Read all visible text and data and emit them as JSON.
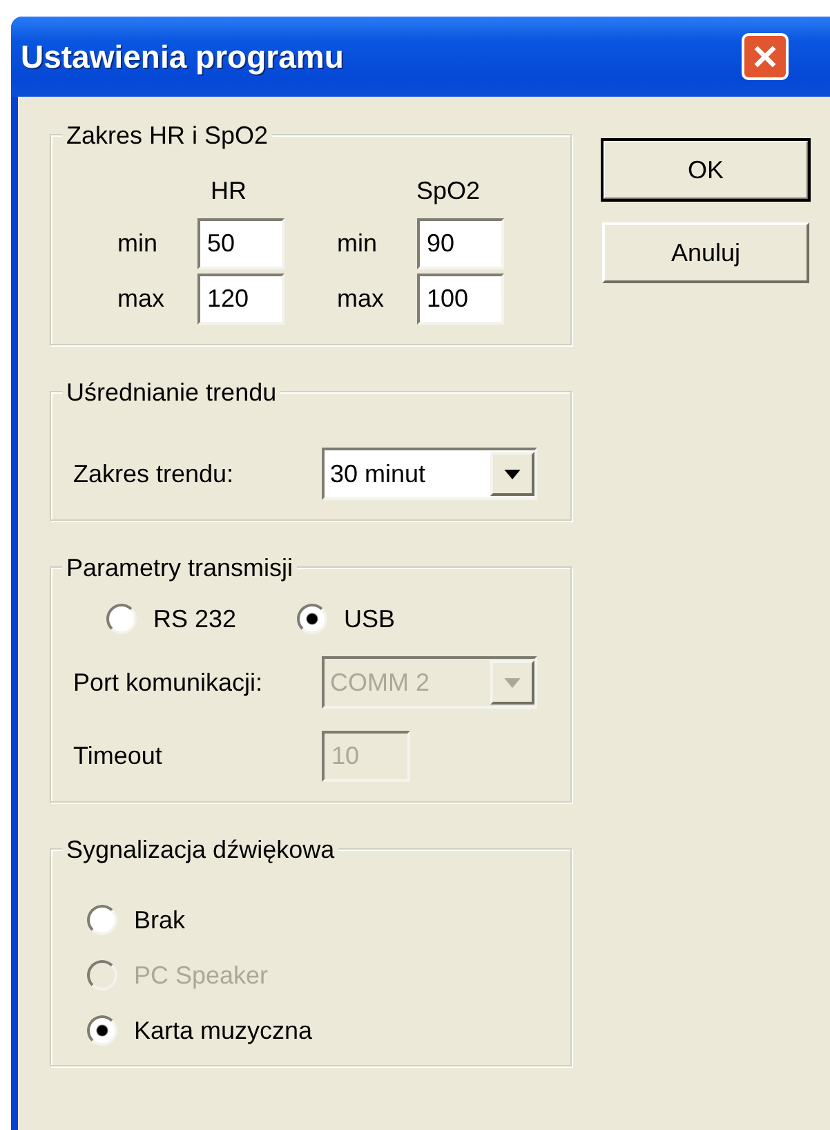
{
  "window": {
    "title": "Ustawienia programu"
  },
  "groups": [
    {
      "title": "Zakres HR i SpO2",
      "items": [
        {
          "kind": "columns",
          "columns": [
            {
              "header": "HR",
              "rows": [
                {
                  "label": "min",
                  "value": "50"
                },
                {
                  "label": "max",
                  "value": "120"
                }
              ]
            },
            {
              "header": "SpO2",
              "rows": [
                {
                  "label": "min",
                  "value": "90"
                },
                {
                  "label": "max",
                  "value": "100"
                }
              ]
            }
          ]
        }
      ]
    },
    {
      "title": "Uśrednianie trendu",
      "items": [
        {
          "kind": "dropdown",
          "label": "Zakres trendu:",
          "value": "30 minut",
          "disabled": false
        }
      ]
    },
    {
      "title": "Parametry transmisji",
      "items": [
        {
          "kind": "radio-row",
          "options": [
            {
              "label": "RS 232",
              "selected": false,
              "disabled": false
            },
            {
              "label": "USB",
              "selected": true,
              "disabled": false
            }
          ]
        },
        {
          "kind": "dropdown",
          "label": "Port komunikacji:",
          "value": "COMM 2",
          "disabled": true
        },
        {
          "kind": "textbox",
          "label": "Timeout",
          "value": "10",
          "disabled": true
        }
      ]
    },
    {
      "title": "Sygnalizacja dźwiękowa",
      "items": [
        {
          "kind": "radio-list",
          "options": [
            {
              "label": "Brak",
              "selected": false,
              "disabled": false
            },
            {
              "label": "PC Speaker",
              "selected": false,
              "disabled": true
            },
            {
              "label": "Karta muzyczna",
              "selected": true,
              "disabled": false
            }
          ]
        }
      ]
    }
  ],
  "buttons": [
    {
      "label": "OK",
      "default": true
    },
    {
      "label": "Anuluj",
      "default": false
    }
  ]
}
